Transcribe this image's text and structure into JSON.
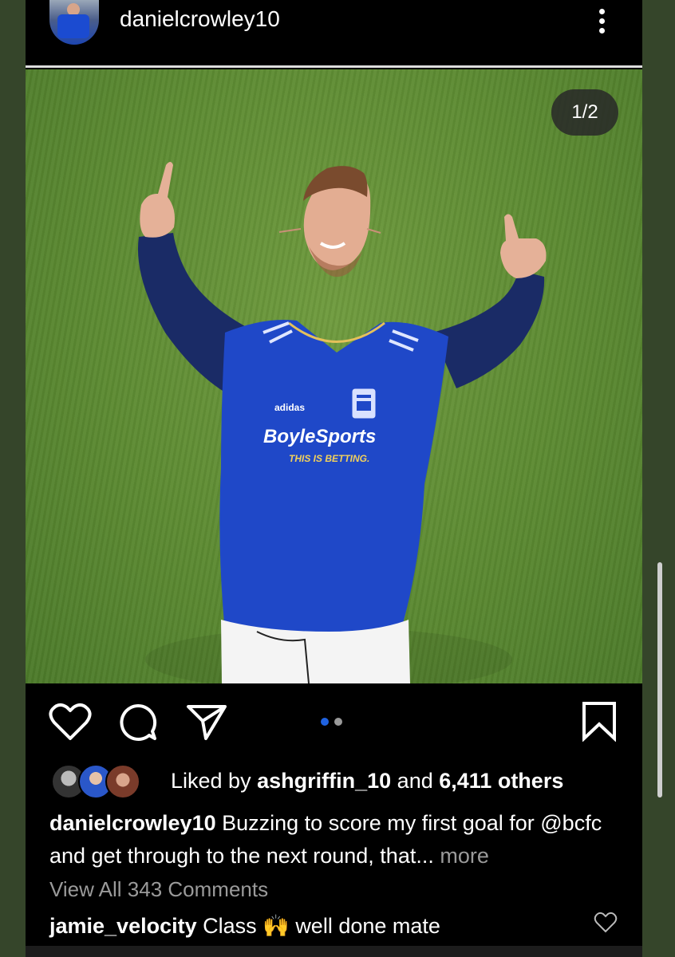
{
  "header": {
    "username": "danielcrowley10"
  },
  "photo": {
    "counter": "1/2",
    "sponsor": "BoyleSports",
    "sponsor_tagline": "THIS IS BETTING.",
    "brand": "adidas"
  },
  "actions": {
    "icons": [
      "heart-icon",
      "comment-icon",
      "share-icon",
      "bookmark-icon"
    ],
    "carousel_position": 1,
    "carousel_total": 2
  },
  "likes": {
    "prefix": "Liked by",
    "user": "ashgriffin_10",
    "mid": "and",
    "others": "6,411 others"
  },
  "caption": {
    "username": "danielcrowley10",
    "text": "Buzzing to score my first goal for @bcfc and get through to the next round, that...",
    "more": "more"
  },
  "view_all": "View All 343 Comments",
  "comment": {
    "username": "jamie_velocity",
    "text_before": "Class",
    "emoji": "🙌",
    "text_after": "well done mate"
  },
  "colors": {
    "accent_blue": "#1f62e0",
    "muted": "#9a9a9a",
    "kit_blue": "#1f48c8"
  }
}
